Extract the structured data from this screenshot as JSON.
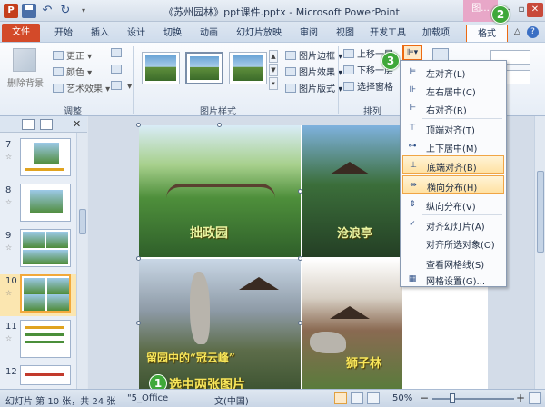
{
  "window": {
    "title": "《苏州园林》ppt课件.pptx - Microsoft PowerPoint",
    "app_logo": "P",
    "context_group": "图..."
  },
  "tabs": [
    "文件",
    "开始",
    "插入",
    "设计",
    "切换",
    "动画",
    "幻灯片放映",
    "审阅",
    "视图",
    "开发工具",
    "加载项",
    "格式"
  ],
  "ribbon": {
    "adjust": {
      "remove_background": "删除背景",
      "corrections": "更正",
      "color": "颜色",
      "artistic_effects": "艺术效果",
      "label": "调整"
    },
    "picture_styles": {
      "border": "图片边框",
      "effects": "图片效果",
      "layout": "图片版式",
      "label": "图片样式"
    },
    "arrange": {
      "bring_forward": "上移一层",
      "send_backward": "下移一层",
      "selection_pane": "选择窗格",
      "label": "排列"
    }
  },
  "align_menu": [
    {
      "label": "左对齐(L)",
      "icon": "align-left-icon"
    },
    {
      "label": "左右居中(C)",
      "icon": "align-center-icon"
    },
    {
      "label": "右对齐(R)",
      "icon": "align-right-icon"
    },
    {
      "label": "顶端对齐(T)",
      "icon": "align-top-icon"
    },
    {
      "label": "上下居中(M)",
      "icon": "align-middle-icon"
    },
    {
      "label": "底端对齐(B)",
      "icon": "align-bottom-icon"
    },
    {
      "label": "横向分布(H)",
      "icon": "distribute-horizontal-icon"
    },
    {
      "label": "纵向分布(V)",
      "icon": "distribute-vertical-icon"
    },
    {
      "label": "对齐幻灯片(A)",
      "icon": "check-icon"
    },
    {
      "label": "对齐所选对象(O)",
      "icon": ""
    },
    {
      "label": "查看网格线(S)",
      "icon": ""
    },
    {
      "label": "网格设置(G)...",
      "icon": "grid-settings-icon"
    }
  ],
  "slides": [
    {
      "number": "7"
    },
    {
      "number": "8"
    },
    {
      "number": "9"
    },
    {
      "number": "10"
    },
    {
      "number": "11"
    },
    {
      "number": "12"
    }
  ],
  "slide_captions": {
    "zhuozheng": "拙政园",
    "canglang": "沧浪亭",
    "liuyuan": "留园中的“冠云峰”",
    "shizilin": "狮子林"
  },
  "annotations": {
    "step1": "1",
    "step2": "2",
    "step3": "3",
    "caption": "选中两张图片"
  },
  "status": {
    "slide_info": "幻灯片 第 10 张，共 24 张",
    "theme": "\"5_Office",
    "language": "文(中国)",
    "zoom": "50%"
  },
  "colors": {
    "file_tab": "#d34a29",
    "highlight_orange": "#ec6a12",
    "callout_green": "#3fa83a"
  }
}
